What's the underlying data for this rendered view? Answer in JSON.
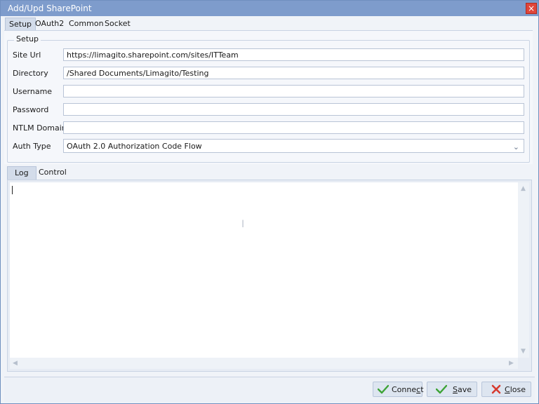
{
  "window": {
    "title": "Add/Upd SharePoint",
    "close_symbol": "×"
  },
  "top_tabs": [
    {
      "label": "Setup",
      "active": true
    },
    {
      "label": "OAuth2",
      "active": false
    },
    {
      "label": "Common",
      "active": false
    },
    {
      "label": "Socket",
      "active": false
    }
  ],
  "setup": {
    "group_title": "Setup",
    "fields": [
      {
        "label": "Site Url",
        "value": "https://limagito.sharepoint.com/sites/ITTeam"
      },
      {
        "label": "Directory",
        "value": "/Shared Documents/Limagito/Testing"
      },
      {
        "label": "Username",
        "value": ""
      },
      {
        "label": "Password",
        "value": ""
      },
      {
        "label": "NTLM Domain",
        "value": ""
      },
      {
        "label": "Auth Type",
        "value": "OAuth 2.0 Authorization Code Flow"
      }
    ]
  },
  "bottom_tabs": [
    {
      "label": "Log",
      "active": true
    },
    {
      "label": "Control",
      "active": false
    }
  ],
  "log": {
    "text": ""
  },
  "buttons": {
    "connect": {
      "pre": "Conne",
      "accel": "c",
      "post": "t"
    },
    "save": {
      "pre": "",
      "accel": "S",
      "post": "ave"
    },
    "close": {
      "pre": "",
      "accel": "C",
      "post": "lose"
    }
  },
  "icons": {
    "connect": "check-icon",
    "save": "check-icon",
    "close": "cross-icon"
  },
  "colors": {
    "titlebar": "#7e9ccc",
    "check": "#3da336",
    "cross": "#d63a2f"
  }
}
